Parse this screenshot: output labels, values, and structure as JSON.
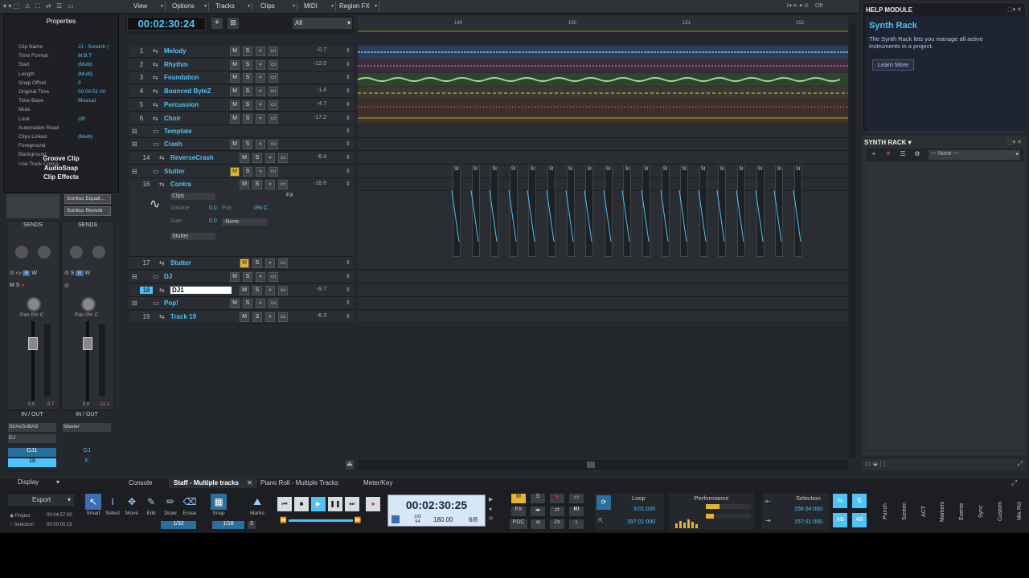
{
  "menu": {
    "items": [
      "View",
      "Options",
      "Tracks",
      "Clips",
      "MIDI",
      "Region FX"
    ],
    "off_label": "Off"
  },
  "transport_top": {
    "time": "00:02:30:24",
    "filter": "All"
  },
  "ruler": {
    "marks": [
      "149",
      "150",
      "151",
      "152"
    ]
  },
  "properties": {
    "title": "Properties",
    "rows": [
      {
        "label": "Clip Name",
        "value": "JJ - Scratch ("
      },
      {
        "label": "Time Format",
        "value": "M:B:T"
      },
      {
        "label": "Start",
        "value": "(Multi)"
      },
      {
        "label": "Length",
        "value": "(Multi)"
      },
      {
        "label": "Snap Offset",
        "value": "0"
      },
      {
        "label": "Original Time",
        "value": "00:00:51:00"
      },
      {
        "label": "Time Base",
        "value": "Musical"
      },
      {
        "label": "Mute",
        "value": ""
      },
      {
        "label": "Lock",
        "value": "Off"
      },
      {
        "label": "Automation Read",
        "value": ""
      },
      {
        "label": "Clips Linked",
        "value": "(Multi)"
      },
      {
        "label": "Foreground",
        "value": ""
      },
      {
        "label": "Background",
        "value": ""
      },
      {
        "label": "Use Track Colors",
        "value": ""
      }
    ],
    "sections": [
      "Groove Clip",
      "AudioSnap",
      "Clip Effects"
    ]
  },
  "strips": [
    {
      "fx": "Sonitus Equali...",
      "sends": "SENDS",
      "pan": "Pan   0% C",
      "io": "IN / OUT",
      "input": "StrAxSnBA9",
      "output": "DJ",
      "name": "DJ1",
      "num": "18",
      "vol_left": "0.0",
      "vol_right": "-9.7"
    },
    {
      "fx": "Sonitus Reverb",
      "sends": "SENDS",
      "pan": "Pan   0% C",
      "io": "IN / OUT",
      "input": "Master",
      "output": "",
      "name": "DJ",
      "num": "F",
      "vol_left": "0.0",
      "vol_right": "-11.1"
    }
  ],
  "tracks": [
    {
      "num": "1",
      "name": "Melody",
      "vol": "-0.7"
    },
    {
      "num": "2",
      "name": "Rhythm",
      "vol": "-12.0"
    },
    {
      "num": "3",
      "name": "Foundation",
      "vol": ""
    },
    {
      "num": "4",
      "name": "Bounced ByteZ",
      "vol": "-1.4"
    },
    {
      "num": "5",
      "name": "Percussion",
      "vol": "-4.7"
    },
    {
      "num": "6",
      "name": "Choir",
      "vol": "-17.2"
    }
  ],
  "folders": {
    "template": "Template",
    "crash": "Crash",
    "reversecrash_num": "14",
    "reversecrash": "ReverseCrash",
    "reversecrash_vol": "-6.4",
    "stutter_folder": "Stutter",
    "contra_num": "16",
    "contra": "Contra",
    "contra_vol": "-18.6",
    "clips_label": "Clips",
    "fx_label": "FX",
    "volume_label": "Volume",
    "volume_val": "0.0",
    "pan_label": "Pan",
    "pan_val": "0% C",
    "gain_label": "Gain",
    "gain_val": "0.0",
    "none_label": "-None-",
    "stutter_sel": "Stutter",
    "stutter_num": "17",
    "stutter": "Stutter",
    "dj_folder": "DJ",
    "dj1_num": "18",
    "dj1": "DJ1",
    "dj1_vol": "-9.7",
    "pop_folder": "Pop!",
    "track19_num": "19",
    "track19": "Track 19",
    "track19_vol": "-6.3"
  },
  "clip_label": "St",
  "help": {
    "header": "HELP MODULE",
    "title": "Synth Rack",
    "body": "The Synth Rack lets you manage all active instruments in a project.",
    "learn": "Learn More"
  },
  "synth_rack": {
    "header": "SYNTH RACK",
    "preset": "--- None ---"
  },
  "bottom_tabs": [
    "Console",
    "Staff - Multiple tracks",
    "Piano Roll - Multiple Tracks",
    "Meter/Key"
  ],
  "display_label": "Display",
  "control_bar": {
    "export": "Export",
    "project": "Project",
    "project_time": "00:04:57:00",
    "selection": "Selection",
    "selection_time": "00:00:00:15",
    "tools": [
      "Smart",
      "Select",
      "Move",
      "Edit",
      "Draw",
      "Erase"
    ],
    "snap": "Snap",
    "marks": "Marks",
    "snap_val": "1/32",
    "snap_val2": "1/16",
    "snap_num": "3",
    "time": "00:02:30:25",
    "tempo": "180.00",
    "meter": "6/8",
    "beats_top": "192",
    "beats_bottom": "64",
    "loop": "Loop",
    "loop_start": "9:01:000",
    "loop_end": "297:01:000",
    "performance": "Performance",
    "selection_label": "Selection",
    "sel_start": "156:04:000",
    "sel_end": "157:01:000",
    "pdc": "PDC",
    "fx": "FX",
    "x2": "2x",
    "ri": "RI",
    "side_tabs": [
      "Punch",
      "Screen",
      "ACT",
      "Markers",
      "Events",
      "Sync",
      "Custom",
      "Mix Rcl"
    ]
  },
  "colors": {
    "accent": "#4fc3f7",
    "bg": "#24272b",
    "mute": "#e5b531",
    "record": "#d13030"
  }
}
